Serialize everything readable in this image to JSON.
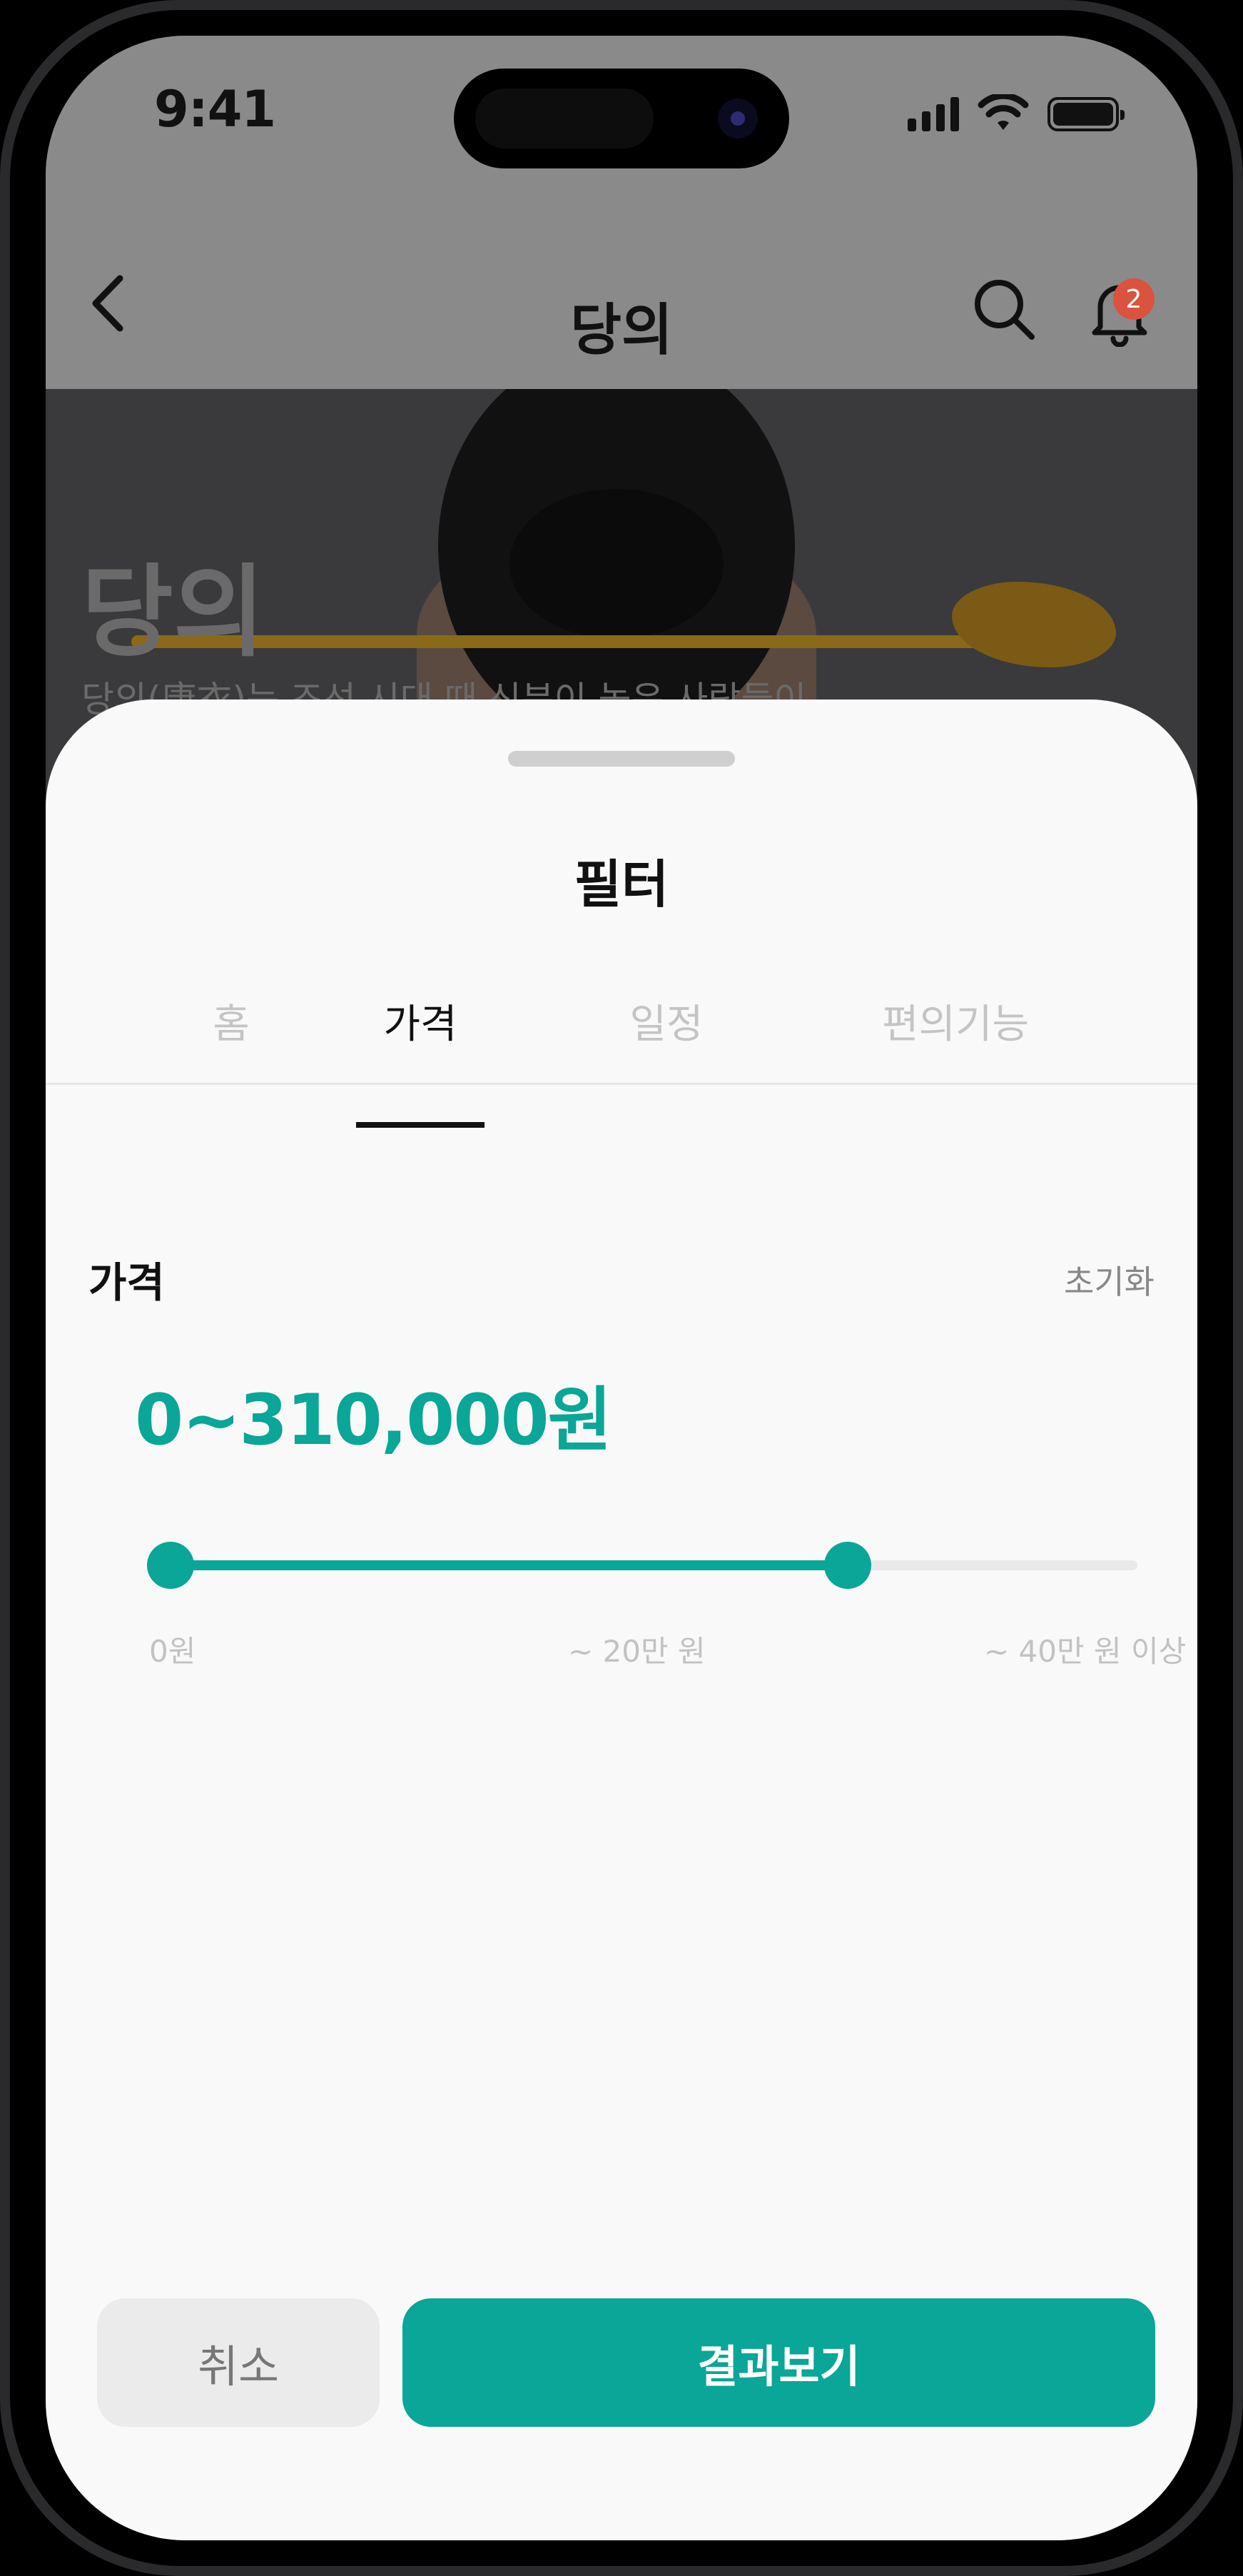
{
  "status_bar": {
    "time": "9:41"
  },
  "header": {
    "title": "당의",
    "notification_count": "2"
  },
  "hero": {
    "title": "당의",
    "description": "당의(唐衣)는 조선 시대 때 신분이 높은 사람들이"
  },
  "filter_sheet": {
    "title": "필터",
    "tabs": [
      {
        "label": "홈",
        "active": false
      },
      {
        "label": "가격",
        "active": true
      },
      {
        "label": "일정",
        "active": false
      },
      {
        "label": "편의기능",
        "active": false
      }
    ],
    "price": {
      "section_label": "가격",
      "reset_label": "초기화",
      "range_text": "0~310,000원",
      "slider_low_fraction": 0,
      "slider_high_fraction": 0.7,
      "ticks": [
        "0원",
        "~ 20만 원",
        "~ 40만 원 이상"
      ]
    },
    "buttons": {
      "cancel": "취소",
      "results": "결과보기"
    }
  },
  "colors": {
    "accent": "#0aa697",
    "badge": "#d9533f"
  },
  "icons": [
    "back-chevron-icon",
    "search-icon",
    "bell-icon",
    "signal-icon",
    "wifi-icon",
    "battery-icon"
  ]
}
